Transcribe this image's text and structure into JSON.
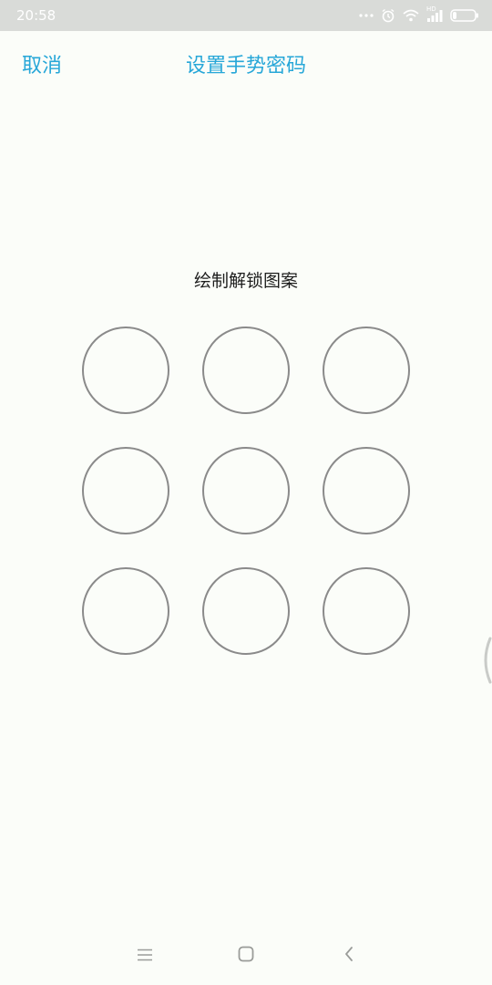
{
  "status_bar": {
    "time": "20:58",
    "icons": [
      "more-dots-icon",
      "alarm-icon",
      "wifi-icon",
      "signal-icon",
      "battery-icon"
    ],
    "signal_label": "HD"
  },
  "header": {
    "cancel_label": "取消",
    "title": "设置手势密码"
  },
  "pattern": {
    "instruction": "绘制解锁图案",
    "dots": [
      1,
      2,
      3,
      4,
      5,
      6,
      7,
      8,
      9
    ]
  },
  "nav_bar": {
    "buttons": [
      "menu-icon",
      "home-icon",
      "back-icon"
    ]
  },
  "colors": {
    "accent": "#27a7d8",
    "status_bar_bg": "#d9dbd8",
    "background": "#fbfdf9",
    "dot_border": "#8a8a8a"
  }
}
